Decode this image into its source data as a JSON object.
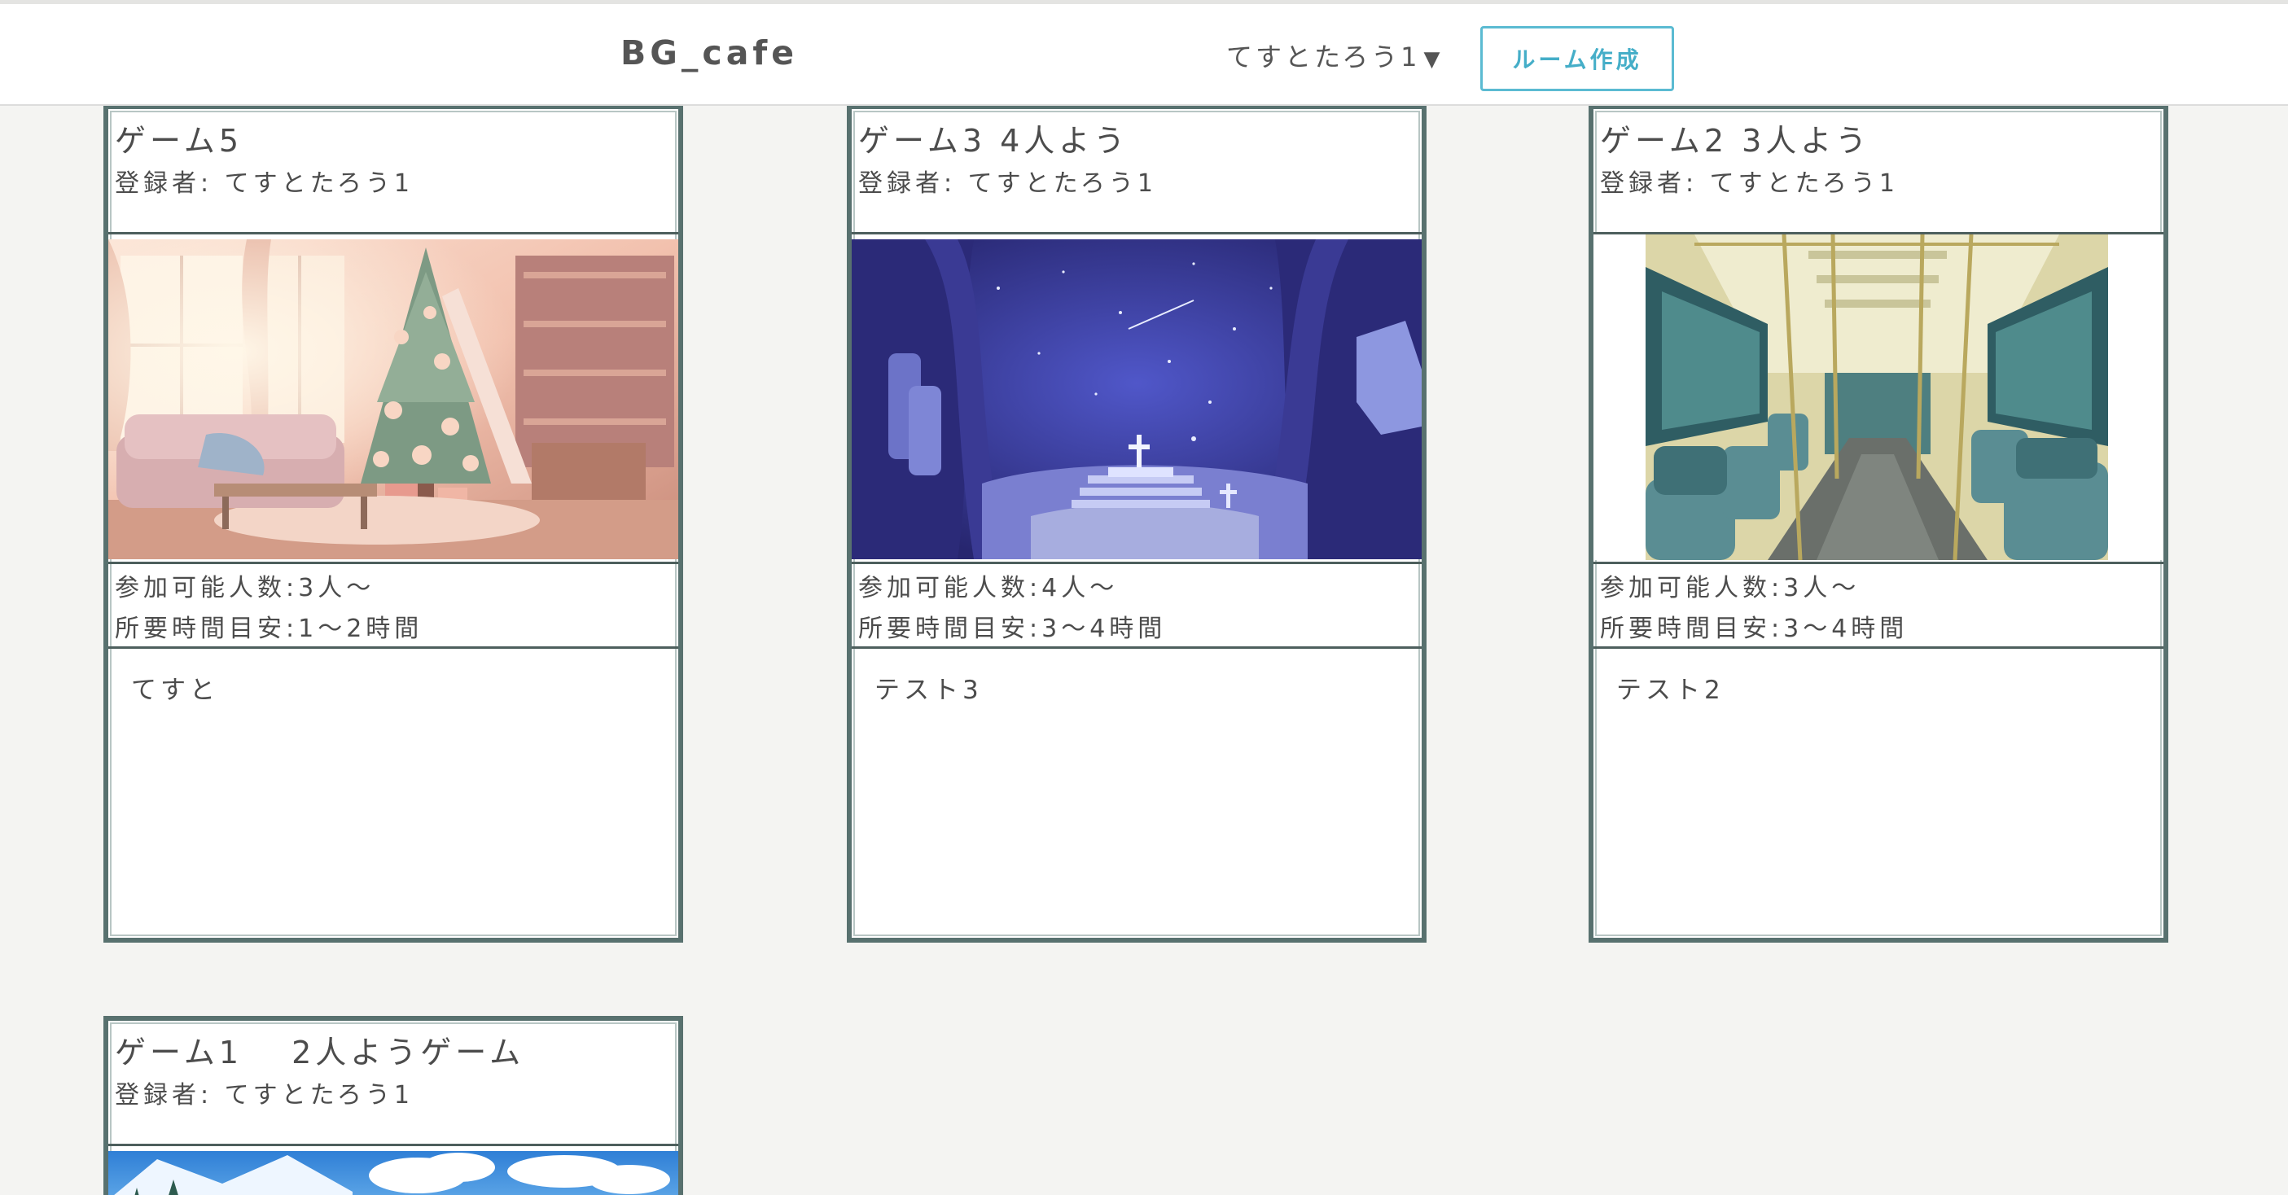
{
  "header": {
    "brand": "BG_cafe",
    "user_name": "てすとたろう1",
    "user_caret": "▼",
    "create_room_label": "ルーム作成"
  },
  "cards": [
    {
      "title": "ゲーム5",
      "owner": "登録者: てすとたろう1",
      "image": "christmas-living-room",
      "players": "参加可能人数:3人〜",
      "duration": "所要時間目安:1〜2時間",
      "description": "てすと"
    },
    {
      "title": "ゲーム3 4人よう",
      "owner": "登録者: てすとたろう1",
      "image": "night-graveyard-forest",
      "players": "参加可能人数:4人〜",
      "duration": "所要時間目安:3〜4時間",
      "description": "テスト3"
    },
    {
      "title": "ゲーム2 3人よう",
      "owner": "登録者: てすとたろう1",
      "image": "train-interior",
      "players": "参加可能人数:3人〜",
      "duration": "所要時間目安:3〜4時間",
      "description": "テスト2"
    },
    {
      "title": "ゲーム1　 2人ようゲーム",
      "owner": "登録者: てすとたろう1",
      "image": "snowy-mountain-sky"
    }
  ],
  "colors": {
    "background": "#f4f4f2",
    "card_border": "#58716f",
    "accent": "#5bbbd2"
  }
}
